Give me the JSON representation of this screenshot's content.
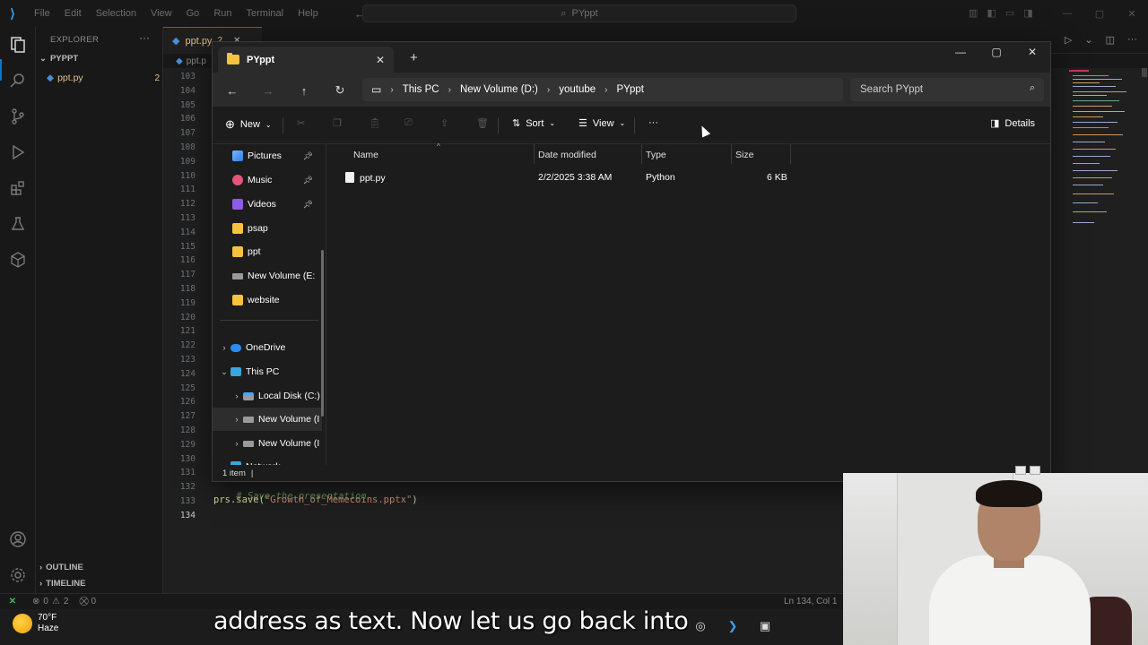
{
  "vscode": {
    "menu": [
      "File",
      "Edit",
      "Selection",
      "View",
      "Go",
      "Run",
      "Terminal",
      "Help"
    ],
    "search": "PYppt",
    "explorer_title": "EXPLORER",
    "folder": "PYPPT",
    "file": "ppt.py",
    "file_badge": "2",
    "tab_label": "ppt.py",
    "tab_badge": "2",
    "breadcrumb": "ppt.p",
    "line_numbers": [
      "103",
      "104",
      "105",
      "106",
      "107",
      "108",
      "109",
      "110",
      "111",
      "112",
      "113",
      "114",
      "115",
      "116",
      "117",
      "118",
      "119",
      "120",
      "121",
      "122",
      "123",
      "124",
      "125",
      "126",
      "127",
      "128",
      "129",
      "130",
      "131",
      "132",
      "133",
      "134"
    ],
    "code": {
      "comment": "# Save the presentation",
      "fn": "prs.save(",
      "str": "\"Growth_of_Memecoins.pptx\"",
      "close": ")"
    },
    "outline": "OUTLINE",
    "timeline": "TIMELINE",
    "status": {
      "errors": "0",
      "warnings": "2",
      "ports": "0",
      "position": "Ln 134, Col 1"
    }
  },
  "explorer_window": {
    "tab_title": "PYppt",
    "breadcrumb": [
      "This PC",
      "New Volume (D:)",
      "youtube",
      "PYppt"
    ],
    "search_placeholder": "Search PYppt",
    "toolbar": {
      "new": "New",
      "sort": "Sort",
      "view": "View",
      "more": "···",
      "details": "Details"
    },
    "nav": [
      {
        "label": "Pictures",
        "icon": "pictures",
        "pinned": true
      },
      {
        "label": "Music",
        "icon": "music",
        "pinned": true
      },
      {
        "label": "Videos",
        "icon": "videos",
        "pinned": true
      },
      {
        "label": "psap",
        "icon": "folder"
      },
      {
        "label": "ppt",
        "icon": "folder"
      },
      {
        "label": "New Volume (E:",
        "icon": "drive"
      },
      {
        "label": "website",
        "icon": "folder"
      },
      {
        "label": "OneDrive",
        "icon": "cloud"
      },
      {
        "label": "This PC",
        "icon": "pc"
      },
      {
        "label": "Local Disk (C:)",
        "icon": "drive-c"
      },
      {
        "label": "New Volume (I",
        "icon": "drive",
        "selected": true
      },
      {
        "label": "New Volume (I",
        "icon": "drive"
      },
      {
        "label": "Network",
        "icon": "network"
      }
    ],
    "columns": [
      "Name",
      "Date modified",
      "Type",
      "Size"
    ],
    "files": [
      {
        "name": "ppt.py",
        "date": "2/2/2025 3:38 AM",
        "type": "Python",
        "size": "6 KB"
      }
    ],
    "status": "1 item"
  },
  "taskbar": {
    "temp": "70°F",
    "condition": "Haze"
  },
  "subtitle": "address as text. Now let us go back into"
}
